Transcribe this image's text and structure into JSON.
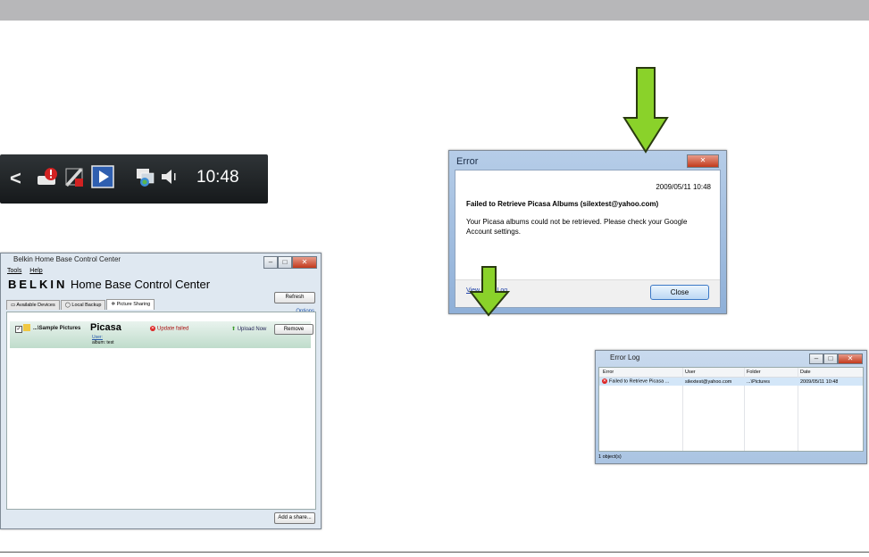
{
  "colors": {
    "accent_green": "#8ad22a",
    "error_red": "#d22222"
  },
  "taskbar": {
    "chevron": "<",
    "icons": [
      "warning-icon",
      "network-error-icon",
      "play-icon",
      "network-icon",
      "volume-icon"
    ],
    "clock": "10:48"
  },
  "belkin_window": {
    "title": "Belkin Home Base Control Center",
    "menu": [
      "Tools",
      "Help"
    ],
    "brand_logo": "BELKIN",
    "brand_name": "Home Base Control Center",
    "refresh_label": "Refresh",
    "options_label": "Options",
    "tabs": [
      "Available Devices",
      "Local Backup",
      "Picture Sharing"
    ],
    "share": {
      "path": "...\\Sample Pictures",
      "service": "Picasa",
      "user_label": "User:",
      "album_label": "album: test",
      "status": "Update failed",
      "upload_label": "Upload Now",
      "remove_label": "Remove"
    },
    "add_share_label": "Add a share..."
  },
  "error_dialog": {
    "title": "Error",
    "timestamp": "2009/05/11 10:48",
    "heading": "Failed to Retrieve Picasa Albums (silextest@yahoo.com)",
    "message": "Your Picasa albums could not be retrieved. Please check your Google Account settings.",
    "link_label": "View Error Log",
    "close_label": "Close"
  },
  "error_log": {
    "title": "Error Log",
    "columns": [
      "Error",
      "User",
      "Folder",
      "Date"
    ],
    "rows": [
      {
        "error": "Failed to Retrieve Picasa ...",
        "user": "silextest@yahoo.com",
        "folder": "...\\Pictures",
        "date": "2009/05/11 10:48"
      }
    ],
    "status": "1 object(s)"
  }
}
